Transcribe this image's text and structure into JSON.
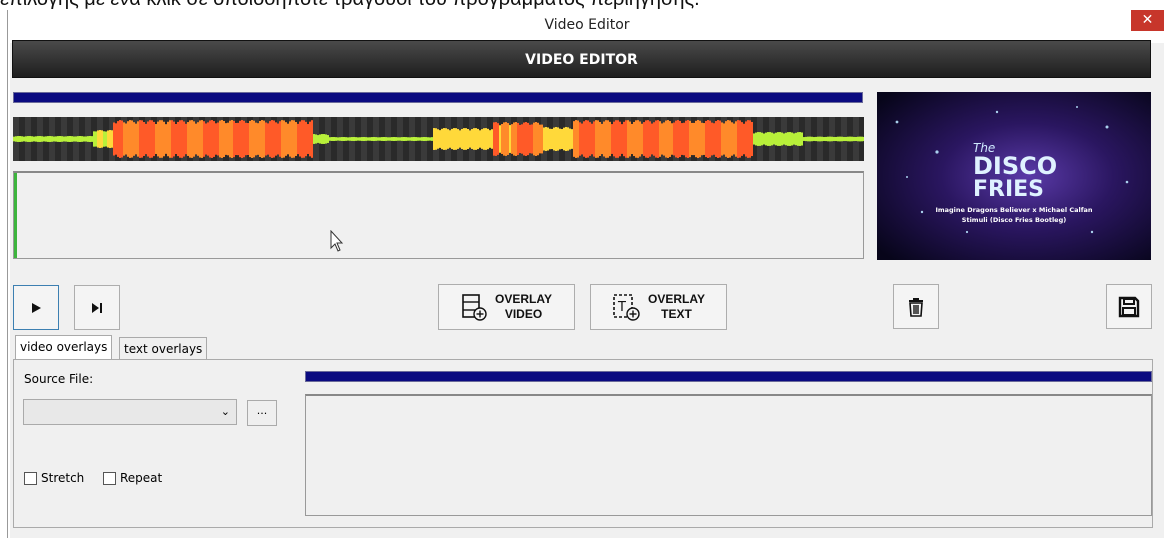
{
  "background_caption": "επιλογής με ένα κλικ σε οποιοδήποτε τραγούδι του προγράμματος περιήγησης.",
  "window": {
    "title": "Video Editor",
    "close_symbol": "✕"
  },
  "header": {
    "title": "VIDEO EDITOR"
  },
  "playback": {
    "play_icon": "play-icon",
    "next_icon": "skip-next-icon"
  },
  "toolbar": {
    "overlay_video_label": "OVERLAY\nVIDEO",
    "overlay_text_label": "OVERLAY\nTEXT",
    "delete_icon": "trash-icon",
    "save_icon": "save-icon"
  },
  "tabs": [
    {
      "label": "video overlays",
      "selected": true
    },
    {
      "label": "text overlays",
      "selected": false
    }
  ],
  "overlay_panel": {
    "source_label": "Source File:",
    "source_value": "",
    "browse_label": "...",
    "stretch_label": "Stretch",
    "repeat_label": "Repeat",
    "stretch_checked": false,
    "repeat_checked": false
  },
  "preview": {
    "title_lines": [
      "The",
      "DISCO",
      "FRIES"
    ],
    "subtitle_line1": "Imagine Dragons Believer x Michael Calfan",
    "subtitle_line2": "Stimuli (Disco Fries Bootleg)"
  },
  "colors": {
    "progress": "#0a0a80",
    "accent_green": "#3cb43c",
    "close_red": "#c7362b"
  }
}
